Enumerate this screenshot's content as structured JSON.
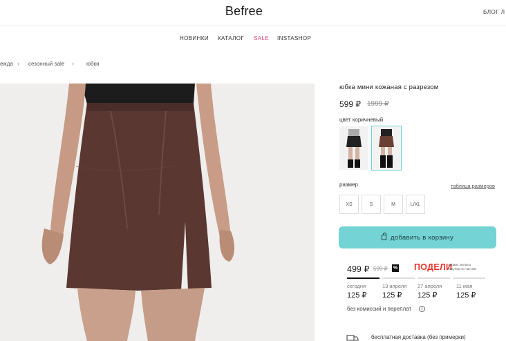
{
  "header": {
    "logo": "Befree",
    "right_text": "БЛОГ  Л"
  },
  "nav": {
    "items": [
      {
        "label": "НОВИНКИ"
      },
      {
        "label": "КАТАЛОГ"
      },
      {
        "label": "SALE"
      },
      {
        "label": "INSTASHOP"
      }
    ]
  },
  "breadcrumbs": [
    {
      "label": "ежда"
    },
    {
      "label": "сезонный sale"
    },
    {
      "label": "юбки"
    }
  ],
  "product": {
    "title": "юбка мини кожаная с разрезом",
    "price": "599 ₽",
    "old_price": "1999 ₽",
    "color_label": "цвет коричневый",
    "size_label": "размер",
    "size_table_link": "таблица размеров",
    "sizes": [
      "XS",
      "S",
      "M",
      "L/XL"
    ],
    "add_to_cart": "добавить в корзину"
  },
  "podeli": {
    "price": "499 ₽",
    "old_price": "599 ₽",
    "percent_badge": "%",
    "logo": "ПОДЕЛИ",
    "tagline": "сервис оплаты покупок по частям",
    "installments": [
      {
        "date": "сегодня",
        "amount": "125 ₽"
      },
      {
        "date": "13 апреля",
        "amount": "125 ₽"
      },
      {
        "date": "27 апреля",
        "amount": "125 ₽"
      },
      {
        "date": "11 мая",
        "amount": "125 ₽"
      }
    ],
    "note": "без комиссий и переплат",
    "info_icon_text": "i"
  },
  "delivery": {
    "text": "бесплатная доставка (без примерки)"
  },
  "colors": {
    "accent": "#74d3d5",
    "sale": "#e0457b",
    "podeli_red": "#e8322a",
    "skirt": "#5a3730"
  }
}
